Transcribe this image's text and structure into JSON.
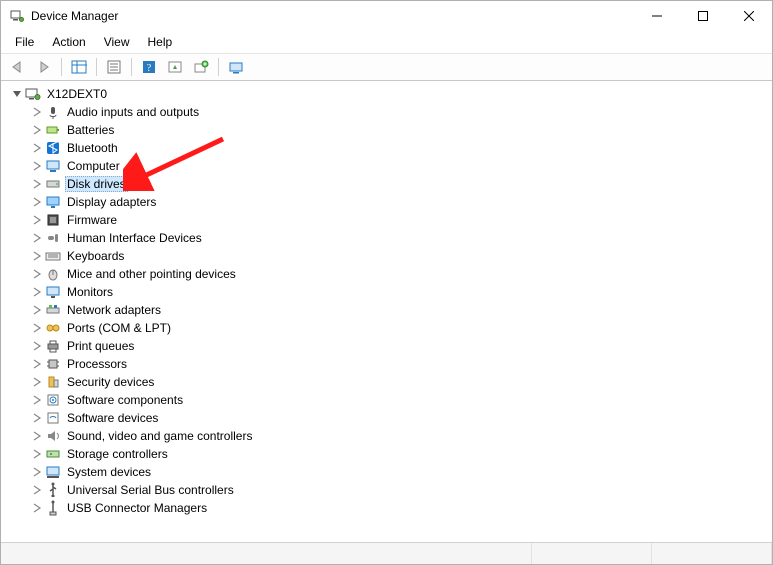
{
  "window": {
    "title": "Device Manager"
  },
  "menu": {
    "items": [
      "File",
      "Action",
      "View",
      "Help"
    ]
  },
  "toolbar": {
    "buttons": [
      "nav-back",
      "nav-forward",
      "|",
      "show-hide-tree",
      "|",
      "properties",
      "|",
      "help",
      "update",
      "uninstall",
      "|",
      "scan-hardware"
    ]
  },
  "root": {
    "label": "X12DEXT0",
    "expanded": true
  },
  "categories": [
    {
      "label": "Audio inputs and outputs",
      "icon": "audio"
    },
    {
      "label": "Batteries",
      "icon": "battery"
    },
    {
      "label": "Bluetooth",
      "icon": "bluetooth"
    },
    {
      "label": "Computer",
      "icon": "computer"
    },
    {
      "label": "Disk drives",
      "icon": "disk",
      "selected": true
    },
    {
      "label": "Display adapters",
      "icon": "display"
    },
    {
      "label": "Firmware",
      "icon": "firmware"
    },
    {
      "label": "Human Interface Devices",
      "icon": "hid"
    },
    {
      "label": "Keyboards",
      "icon": "keyboard"
    },
    {
      "label": "Mice and other pointing devices",
      "icon": "mouse"
    },
    {
      "label": "Monitors",
      "icon": "monitor"
    },
    {
      "label": "Network adapters",
      "icon": "network"
    },
    {
      "label": "Ports (COM & LPT)",
      "icon": "ports"
    },
    {
      "label": "Print queues",
      "icon": "printer"
    },
    {
      "label": "Processors",
      "icon": "cpu"
    },
    {
      "label": "Security devices",
      "icon": "security"
    },
    {
      "label": "Software components",
      "icon": "swcomp"
    },
    {
      "label": "Software devices",
      "icon": "swdev"
    },
    {
      "label": "Sound, video and game controllers",
      "icon": "sound"
    },
    {
      "label": "Storage controllers",
      "icon": "storage"
    },
    {
      "label": "System devices",
      "icon": "system"
    },
    {
      "label": "Universal Serial Bus controllers",
      "icon": "usb"
    },
    {
      "label": "USB Connector Managers",
      "icon": "usbconn"
    }
  ],
  "annotation": {
    "arrow_points_to": "Disk drives"
  }
}
